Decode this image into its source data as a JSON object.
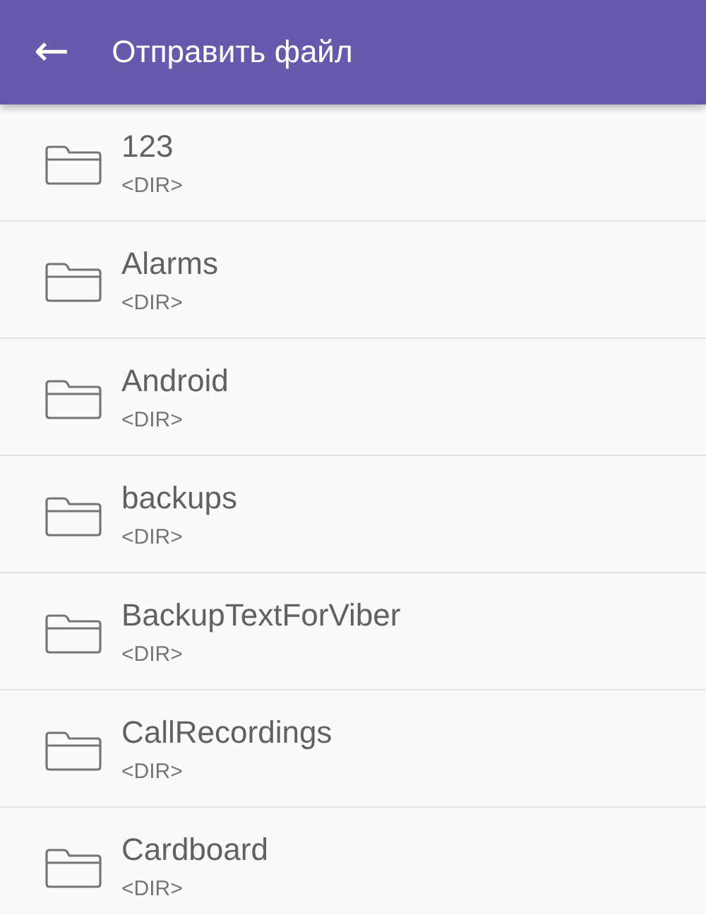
{
  "toolbar": {
    "back": "←",
    "title": "Отправить файл"
  },
  "files": [
    {
      "name": "123",
      "type": "<DIR>"
    },
    {
      "name": "Alarms",
      "type": "<DIR>"
    },
    {
      "name": "Android",
      "type": "<DIR>"
    },
    {
      "name": "backups",
      "type": "<DIR>"
    },
    {
      "name": "BackupTextForViber",
      "type": "<DIR>"
    },
    {
      "name": "CallRecordings",
      "type": "<DIR>"
    },
    {
      "name": "Cardboard",
      "type": "<DIR>"
    }
  ]
}
